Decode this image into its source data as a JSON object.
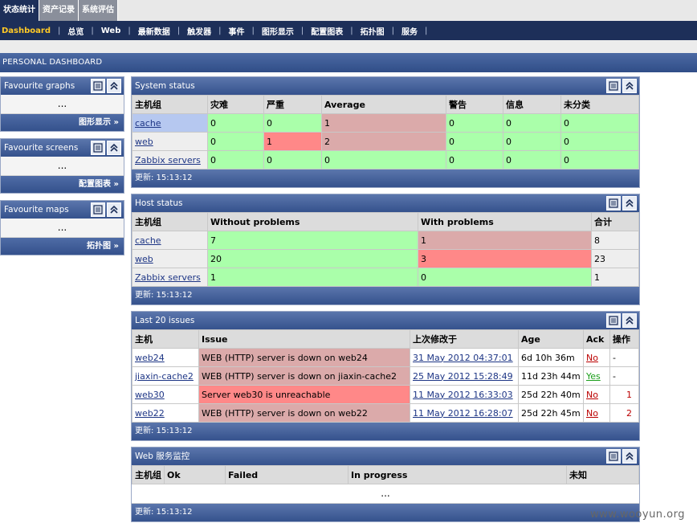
{
  "top_tabs": [
    {
      "label": "状态统计",
      "active": true
    },
    {
      "label": "资产记录",
      "active": false
    },
    {
      "label": "系统评估",
      "active": false
    }
  ],
  "menu": [
    "Dashboard",
    "总览",
    "Web",
    "最新数据",
    "触发器",
    "事件",
    "图形显示",
    "配置图表",
    "拓扑图",
    "服务"
  ],
  "menu_separator": "|",
  "page_title": "PERSONAL DASHBOARD",
  "favourites": [
    {
      "title": "Favourite graphs",
      "body": "...",
      "link": "图形显示 »"
    },
    {
      "title": "Favourite screens",
      "body": "...",
      "link": "配置图表 »"
    },
    {
      "title": "Favourite maps",
      "body": "...",
      "link": "拓扑图 »"
    }
  ],
  "system_status": {
    "title": "System status",
    "columns": [
      "主机组",
      "灾难",
      "严重",
      "Average",
      "警告",
      "信息",
      "未分类"
    ],
    "rows": [
      {
        "group": "cache",
        "values": [
          "0",
          "0",
          "1",
          "0",
          "0",
          "0"
        ]
      },
      {
        "group": "web",
        "values": [
          "0",
          "1",
          "2",
          "0",
          "0",
          "0"
        ]
      },
      {
        "group": "Zabbix servers",
        "values": [
          "0",
          "0",
          "0",
          "0",
          "0",
          "0"
        ]
      }
    ],
    "footer": "更新: 15:13:12"
  },
  "host_status": {
    "title": "Host status",
    "columns": [
      "主机组",
      "Without problems",
      "With problems",
      "合计"
    ],
    "rows": [
      {
        "group": "cache",
        "values": [
          "7",
          "1",
          "8"
        ]
      },
      {
        "group": "web",
        "values": [
          "20",
          "3",
          "23"
        ]
      },
      {
        "group": "Zabbix servers",
        "values": [
          "1",
          "0",
          "1"
        ]
      }
    ],
    "footer": "更新: 15:13:12"
  },
  "last_issues": {
    "title": "Last 20 issues",
    "columns": [
      "主机",
      "Issue",
      "上次修改于",
      "Age",
      "Ack",
      "操作"
    ],
    "rows": [
      {
        "host": "web24",
        "issue": "WEB (HTTP) server is down on web24",
        "changed": "31 May 2012 04:37:01",
        "age": "6d 10h 36m",
        "ack": "No",
        "actions": "-"
      },
      {
        "host": "jiaxin-cache2",
        "issue": "WEB (HTTP) server is down on jiaxin-cache2",
        "changed": "25 May 2012 15:28:49",
        "age": "11d 23h 44m",
        "ack": "Yes",
        "actions": "-"
      },
      {
        "host": "web30",
        "issue": "Server web30 is unreachable",
        "changed": "11 May 2012 16:33:03",
        "age": "25d 22h 40m",
        "ack": "No",
        "actions": "1"
      },
      {
        "host": "web22",
        "issue": "WEB (HTTP) server is down on web22",
        "changed": "11 May 2012 16:28:07",
        "age": "25d 22h 45m",
        "ack": "No",
        "actions": "2"
      }
    ],
    "footer": "更新: 15:13:12"
  },
  "web_monitoring": {
    "title": "Web 服务监控",
    "columns": [
      "主机组",
      "Ok",
      "Failed",
      "In progress",
      "未知"
    ],
    "body": "...",
    "footer": "更新: 15:13:12"
  },
  "watermark": "www.wooyun.org",
  "colors": {
    "ok": "#aaffaa",
    "problem_avg": "#dbaaaa",
    "problem_high": "#ff8888",
    "header": "#1d2f59",
    "active_menu": "#ffc926"
  }
}
